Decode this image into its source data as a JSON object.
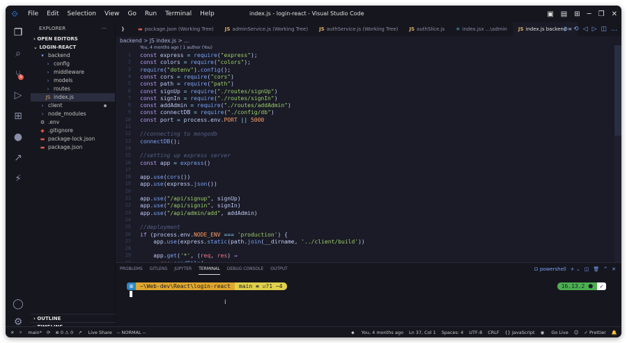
{
  "titlebar": {
    "menus": [
      "File",
      "Edit",
      "Selection",
      "View",
      "Go",
      "Run",
      "Terminal",
      "Help"
    ],
    "title": "index.js - login-react - Visual Studio Code"
  },
  "sidebar": {
    "header": "EXPLORER",
    "dots": "···",
    "open_editors": "OPEN EDITORS",
    "project": "LOGIN-REACT",
    "tree": [
      {
        "label": "backend",
        "icon": "folder-icon",
        "glyph": "▾",
        "indent": 1
      },
      {
        "label": "config",
        "icon": "folder-icon",
        "glyph": "›",
        "indent": 2
      },
      {
        "label": "middleware",
        "icon": "folder-icon",
        "glyph": "›",
        "indent": 2
      },
      {
        "label": "models",
        "icon": "folder-icon",
        "glyph": "›",
        "indent": 2
      },
      {
        "label": "routes",
        "icon": "folder-icon",
        "glyph": "›",
        "indent": 2
      },
      {
        "label": "index.js",
        "icon": "js-icon",
        "glyph": "JS",
        "indent": 2,
        "selected": true
      },
      {
        "label": "client",
        "icon": "folder-icon",
        "glyph": "›",
        "indent": 1,
        "dot": true
      },
      {
        "label": "node_modules",
        "icon": "folder-icon",
        "glyph": "›",
        "indent": 1
      },
      {
        "label": ".env",
        "icon": "gear-icon",
        "glyph": "⚙",
        "indent": 1
      },
      {
        "label": ".gitignore",
        "icon": "git-icon",
        "glyph": "◆",
        "indent": 1
      },
      {
        "label": "package-lock.json",
        "icon": "npm-icon",
        "glyph": "▬",
        "indent": 1
      },
      {
        "label": "package.json",
        "icon": "npm-icon",
        "glyph": "▬",
        "indent": 1
      }
    ],
    "outline": "OUTLINE",
    "timeline": "TIMELINE"
  },
  "tabs": [
    {
      "icon": "}",
      "label": "",
      "active": false
    },
    {
      "icon": "▬",
      "label": "package.json (Working Tree)",
      "active": false
    },
    {
      "icon": "JS",
      "label": "adminService.js (Working Tree)",
      "active": false
    },
    {
      "icon": "JS",
      "label": "authService.js (Working Tree)",
      "active": false
    },
    {
      "icon": "JS",
      "label": "authSlice.js",
      "active": false
    },
    {
      "icon": "⚛",
      "label": "index.jsx ...\\admin",
      "active": false
    },
    {
      "icon": "JS",
      "label": "index.js backend ×",
      "active": true
    }
  ],
  "breadcrumb": "backend > JS index.js > ...",
  "blame": "You, 4 months ago | 1 author (You)",
  "code_lines": [
    [
      [
        "k",
        "const "
      ],
      [
        "v",
        "express "
      ],
      [
        "o",
        "= "
      ],
      [
        "f",
        "require"
      ],
      [
        "v",
        "("
      ],
      [
        "s",
        "\"express\""
      ],
      [
        "v",
        ");"
      ]
    ],
    [
      [
        "k",
        "const "
      ],
      [
        "v",
        "colors "
      ],
      [
        "o",
        "= "
      ],
      [
        "f",
        "require"
      ],
      [
        "v",
        "("
      ],
      [
        "s",
        "\"colors\""
      ],
      [
        "v",
        ");"
      ]
    ],
    [
      [
        "f",
        "require"
      ],
      [
        "v",
        "("
      ],
      [
        "s",
        "\"dotenv\""
      ],
      [
        "v",
        ")."
      ],
      [
        "f",
        "config"
      ],
      [
        "v",
        "();"
      ]
    ],
    [
      [
        "k",
        "const "
      ],
      [
        "v",
        "cors "
      ],
      [
        "o",
        "= "
      ],
      [
        "f",
        "require"
      ],
      [
        "v",
        "("
      ],
      [
        "s",
        "\"cors\""
      ],
      [
        "v",
        ")"
      ]
    ],
    [
      [
        "k",
        "const "
      ],
      [
        "v",
        "path "
      ],
      [
        "o",
        "= "
      ],
      [
        "f",
        "require"
      ],
      [
        "v",
        "("
      ],
      [
        "s",
        "\"path\""
      ],
      [
        "v",
        ")"
      ]
    ],
    [
      [
        "k",
        "const "
      ],
      [
        "v",
        "signUp "
      ],
      [
        "o",
        "= "
      ],
      [
        "f",
        "require"
      ],
      [
        "v",
        "("
      ],
      [
        "s",
        "\"./routes/signUp\""
      ],
      [
        "v",
        ")"
      ]
    ],
    [
      [
        "k",
        "const "
      ],
      [
        "v",
        "signIn "
      ],
      [
        "o",
        "= "
      ],
      [
        "f",
        "require"
      ],
      [
        "v",
        "("
      ],
      [
        "s",
        "\"./routes/signIn\""
      ],
      [
        "v",
        ")"
      ]
    ],
    [
      [
        "k",
        "const "
      ],
      [
        "v",
        "addAdmin "
      ],
      [
        "o",
        "= "
      ],
      [
        "f",
        "require"
      ],
      [
        "v",
        "("
      ],
      [
        "s",
        "\"./routes/addAdmin\""
      ],
      [
        "v",
        ")"
      ]
    ],
    [
      [
        "k",
        "const "
      ],
      [
        "v",
        "connectDB "
      ],
      [
        "o",
        "= "
      ],
      [
        "f",
        "require"
      ],
      [
        "v",
        "("
      ],
      [
        "s",
        "\"./config/db\""
      ],
      [
        "v",
        ")"
      ]
    ],
    [
      [
        "k",
        "const "
      ],
      [
        "v",
        "port "
      ],
      [
        "o",
        "= "
      ],
      [
        "v",
        "process.env."
      ],
      [
        "n",
        "PORT "
      ],
      [
        "o",
        "|| "
      ],
      [
        "n",
        "5000"
      ]
    ],
    [],
    [
      [
        "c",
        "//connecting to mongodb"
      ]
    ],
    [
      [
        "f",
        "connectDB"
      ],
      [
        "v",
        "();"
      ]
    ],
    [],
    [
      [
        "c",
        "//setting up express server"
      ]
    ],
    [
      [
        "k",
        "const "
      ],
      [
        "v",
        "app "
      ],
      [
        "o",
        "= "
      ],
      [
        "f",
        "express"
      ],
      [
        "v",
        "()"
      ]
    ],
    [],
    [
      [
        "v",
        "app."
      ],
      [
        "f",
        "use"
      ],
      [
        "v",
        "("
      ],
      [
        "f",
        "cors"
      ],
      [
        "v",
        "())"
      ]
    ],
    [
      [
        "v",
        "app."
      ],
      [
        "f",
        "use"
      ],
      [
        "v",
        "(express."
      ],
      [
        "f",
        "json"
      ],
      [
        "v",
        "())"
      ]
    ],
    [],
    [
      [
        "v",
        "app."
      ],
      [
        "f",
        "use"
      ],
      [
        "v",
        "("
      ],
      [
        "s",
        "\"/api/signup\""
      ],
      [
        "v",
        ", signUp)"
      ]
    ],
    [
      [
        "v",
        "app."
      ],
      [
        "f",
        "use"
      ],
      [
        "v",
        "("
      ],
      [
        "s",
        "\"/api/signin\""
      ],
      [
        "v",
        ", signIn)"
      ]
    ],
    [
      [
        "v",
        "app."
      ],
      [
        "f",
        "use"
      ],
      [
        "v",
        "("
      ],
      [
        "s",
        "\"/api/admin/add\""
      ],
      [
        "v",
        ", addAdmin)"
      ]
    ],
    [],
    [
      [
        "c",
        "//deployment"
      ]
    ],
    [
      [
        "k",
        "if "
      ],
      [
        "v",
        "(process.env."
      ],
      [
        "n",
        "NODE_ENV "
      ],
      [
        "o",
        "=== "
      ],
      [
        "s",
        "'production'"
      ],
      [
        "v",
        ") {"
      ]
    ],
    [
      [
        "v",
        "    app."
      ],
      [
        "f",
        "use"
      ],
      [
        "v",
        "(express."
      ],
      [
        "f",
        "static"
      ],
      [
        "v",
        "(path."
      ],
      [
        "f",
        "join"
      ],
      [
        "v",
        "(__dirname, "
      ],
      [
        "s",
        "'../client/build'"
      ],
      [
        "v",
        "))"
      ]
    ],
    [],
    [
      [
        "v",
        "    app."
      ],
      [
        "f",
        "get"
      ],
      [
        "v",
        "("
      ],
      [
        "s",
        "'*'"
      ],
      [
        "v",
        ", ("
      ],
      [
        "r",
        "req"
      ],
      [
        "v",
        ", "
      ],
      [
        "r",
        "res"
      ],
      [
        "v",
        ") "
      ],
      [
        "k",
        "⇒"
      ]
    ],
    [
      [
        "v",
        "      "
      ],
      [
        "r",
        "res"
      ],
      [
        "v",
        "."
      ],
      [
        "f",
        "sendFile"
      ],
      [
        "v",
        "("
      ]
    ]
  ],
  "panel": {
    "tabs": [
      "PROBLEMS",
      "GITLENS",
      "JUPYTER",
      "TERMINAL",
      "DEBUG CONSOLE",
      "OUTPUT"
    ],
    "active_tab": "TERMINAL",
    "shell": "powershell",
    "prompt_icon": "⊞",
    "prompt_path": "~\\Web-dev\\React\\login-react",
    "prompt_git": "main ≡ ☑?1 ~4",
    "node_version": "16.13.2 ⬢",
    "check": "✓"
  },
  "status": {
    "branch": "main*",
    "sync": "⟳",
    "errors": "⊗ 0 ⚠ 0",
    "live_share": "Live Share",
    "mode": "-- NORMAL --",
    "blame": "You, 4 months ago",
    "position": "Ln 37, Col 1",
    "spaces": "Spaces: 4",
    "encoding": "UTF-8",
    "eol": "CRLF",
    "language": "{} JavaScript",
    "go_live": "Go Live",
    "prettier": "✓ Prettier"
  }
}
